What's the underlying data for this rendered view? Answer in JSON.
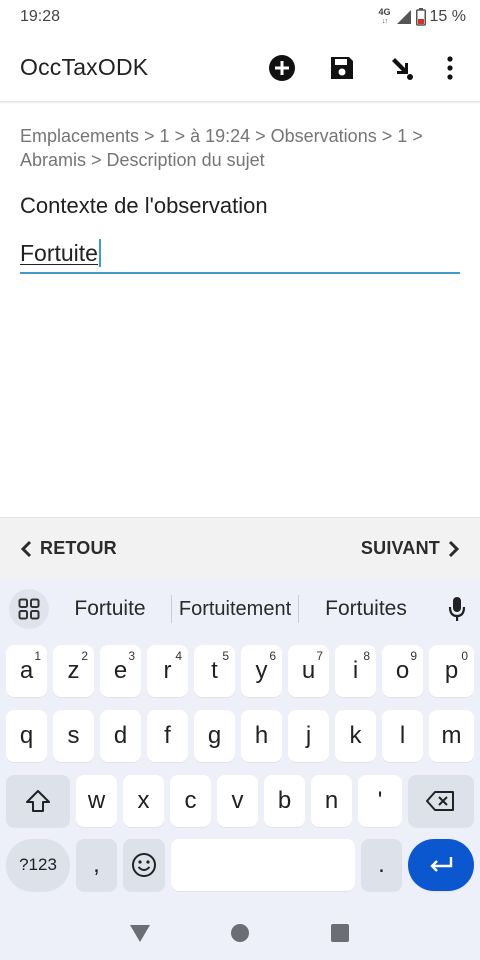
{
  "status_bar": {
    "time": "19:28",
    "network": "4G",
    "battery": "15 %"
  },
  "app_bar": {
    "title": "OccTaxODK",
    "actions": [
      "add-circle-icon",
      "save-icon",
      "arrow-down-right-icon",
      "more-vert-icon"
    ]
  },
  "form": {
    "breadcrumb": "Emplacements > 1 > à 19:24 > Observations > 1 > Abramis > Description du sujet",
    "question": "Contexte de l'observation",
    "answer_value": "Fortuite"
  },
  "navigation": {
    "back_label": "RETOUR",
    "next_label": "SUIVANT"
  },
  "keyboard": {
    "suggestions": [
      "Fortuite",
      "Fortuitement",
      "Fortuites"
    ],
    "row1": [
      {
        "k": "a",
        "h": "1"
      },
      {
        "k": "z",
        "h": "2"
      },
      {
        "k": "e",
        "h": "3"
      },
      {
        "k": "r",
        "h": "4"
      },
      {
        "k": "t",
        "h": "5"
      },
      {
        "k": "y",
        "h": "6"
      },
      {
        "k": "u",
        "h": "7"
      },
      {
        "k": "i",
        "h": "8"
      },
      {
        "k": "o",
        "h": "9"
      },
      {
        "k": "p",
        "h": "0"
      }
    ],
    "row2": [
      "q",
      "s",
      "d",
      "f",
      "g",
      "h",
      "j",
      "k",
      "l",
      "m"
    ],
    "row3": [
      "w",
      "x",
      "c",
      "v",
      "b",
      "n",
      "'"
    ],
    "symbols_label": "?123",
    "comma": ",",
    "period": ".",
    "accent_color": "#0b57d0"
  }
}
